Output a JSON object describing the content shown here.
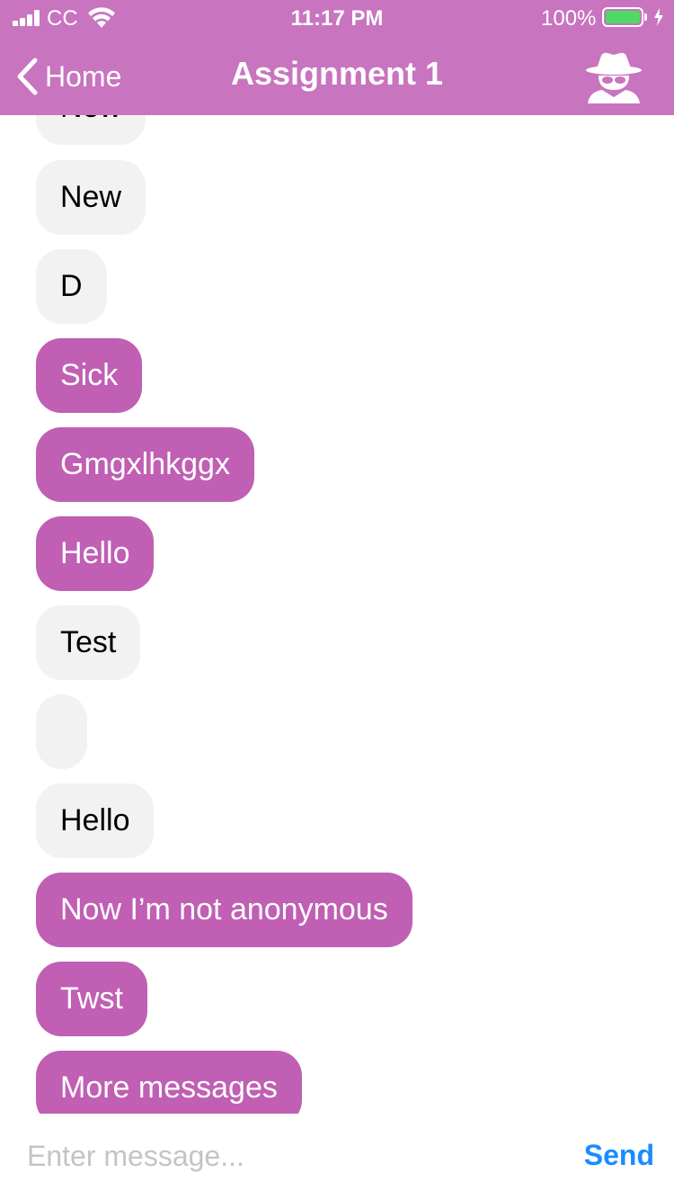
{
  "status_bar": {
    "carrier": "CC",
    "time": "11:17 PM",
    "battery_percent": "100%",
    "battery_level": 1.0,
    "charging": true
  },
  "nav": {
    "back_label": "Home",
    "title": "Assignment 1",
    "right_icon": "incognito-spy-icon"
  },
  "messages": [
    {
      "text": "New",
      "type": "received"
    },
    {
      "text": "New",
      "type": "received"
    },
    {
      "text": "D",
      "type": "received"
    },
    {
      "text": "Sick",
      "type": "sent"
    },
    {
      "text": "Gmgxlhkggx",
      "type": "sent"
    },
    {
      "text": "Hello",
      "type": "sent"
    },
    {
      "text": "Test",
      "type": "received"
    },
    {
      "text": "",
      "type": "received"
    },
    {
      "text": "Hello",
      "type": "received"
    },
    {
      "text": "Now I’m not anonymous",
      "type": "sent"
    },
    {
      "text": "Twst",
      "type": "sent"
    },
    {
      "text": "More messages",
      "type": "sent"
    }
  ],
  "composer": {
    "placeholder": "Enter message...",
    "value": "",
    "send_label": "Send"
  },
  "colors": {
    "header": "#c874bf",
    "sent_bubble": "#c05fb3",
    "received_bubble": "#f2f2f2",
    "send_button": "#1a8cff"
  }
}
